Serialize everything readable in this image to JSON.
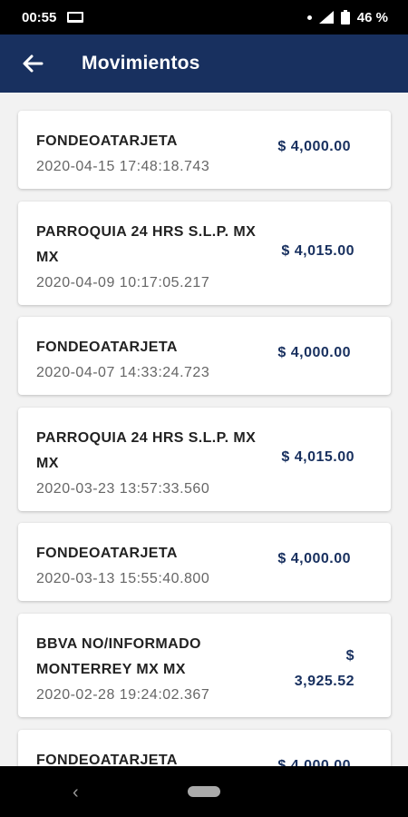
{
  "status_bar": {
    "time": "00:55",
    "battery": "46 %"
  },
  "app_bar": {
    "title": "Movimientos"
  },
  "transactions": [
    {
      "title": "FONDEOATARJETA",
      "date": "2020-04-15 17:48:18.743",
      "amount": "$ 4,000.00"
    },
    {
      "title": "PARROQUIA 24 HRS S.L.P. MX MX",
      "date": "2020-04-09 10:17:05.217",
      "amount": "$ 4,015.00"
    },
    {
      "title": "FONDEOATARJETA",
      "date": "2020-04-07 14:33:24.723",
      "amount": "$ 4,000.00"
    },
    {
      "title": "PARROQUIA 24 HRS S.L.P. MX MX",
      "date": "2020-03-23 13:57:33.560",
      "amount": "$ 4,015.00"
    },
    {
      "title": "FONDEOATARJETA",
      "date": "2020-03-13 15:55:40.800",
      "amount": "$ 4,000.00"
    },
    {
      "title": "BBVA NO/INFORMADO MONTERREY MX MX",
      "date": "2020-02-28 19:24:02.367",
      "amount": "$ 3,925.52"
    },
    {
      "title": "FONDEOATARJETA",
      "date": "",
      "amount": "$ 4,000.00"
    }
  ],
  "icons": {
    "back": "arrow-left-icon",
    "status": [
      "laptop-icon",
      "dot-icon",
      "signal-icon",
      "battery-icon"
    ],
    "nav": [
      "nav-back-icon",
      "nav-home-pill"
    ]
  },
  "colors": {
    "app_bar": "#18305f",
    "amount": "#18305f",
    "background": "#f2f2f2"
  }
}
